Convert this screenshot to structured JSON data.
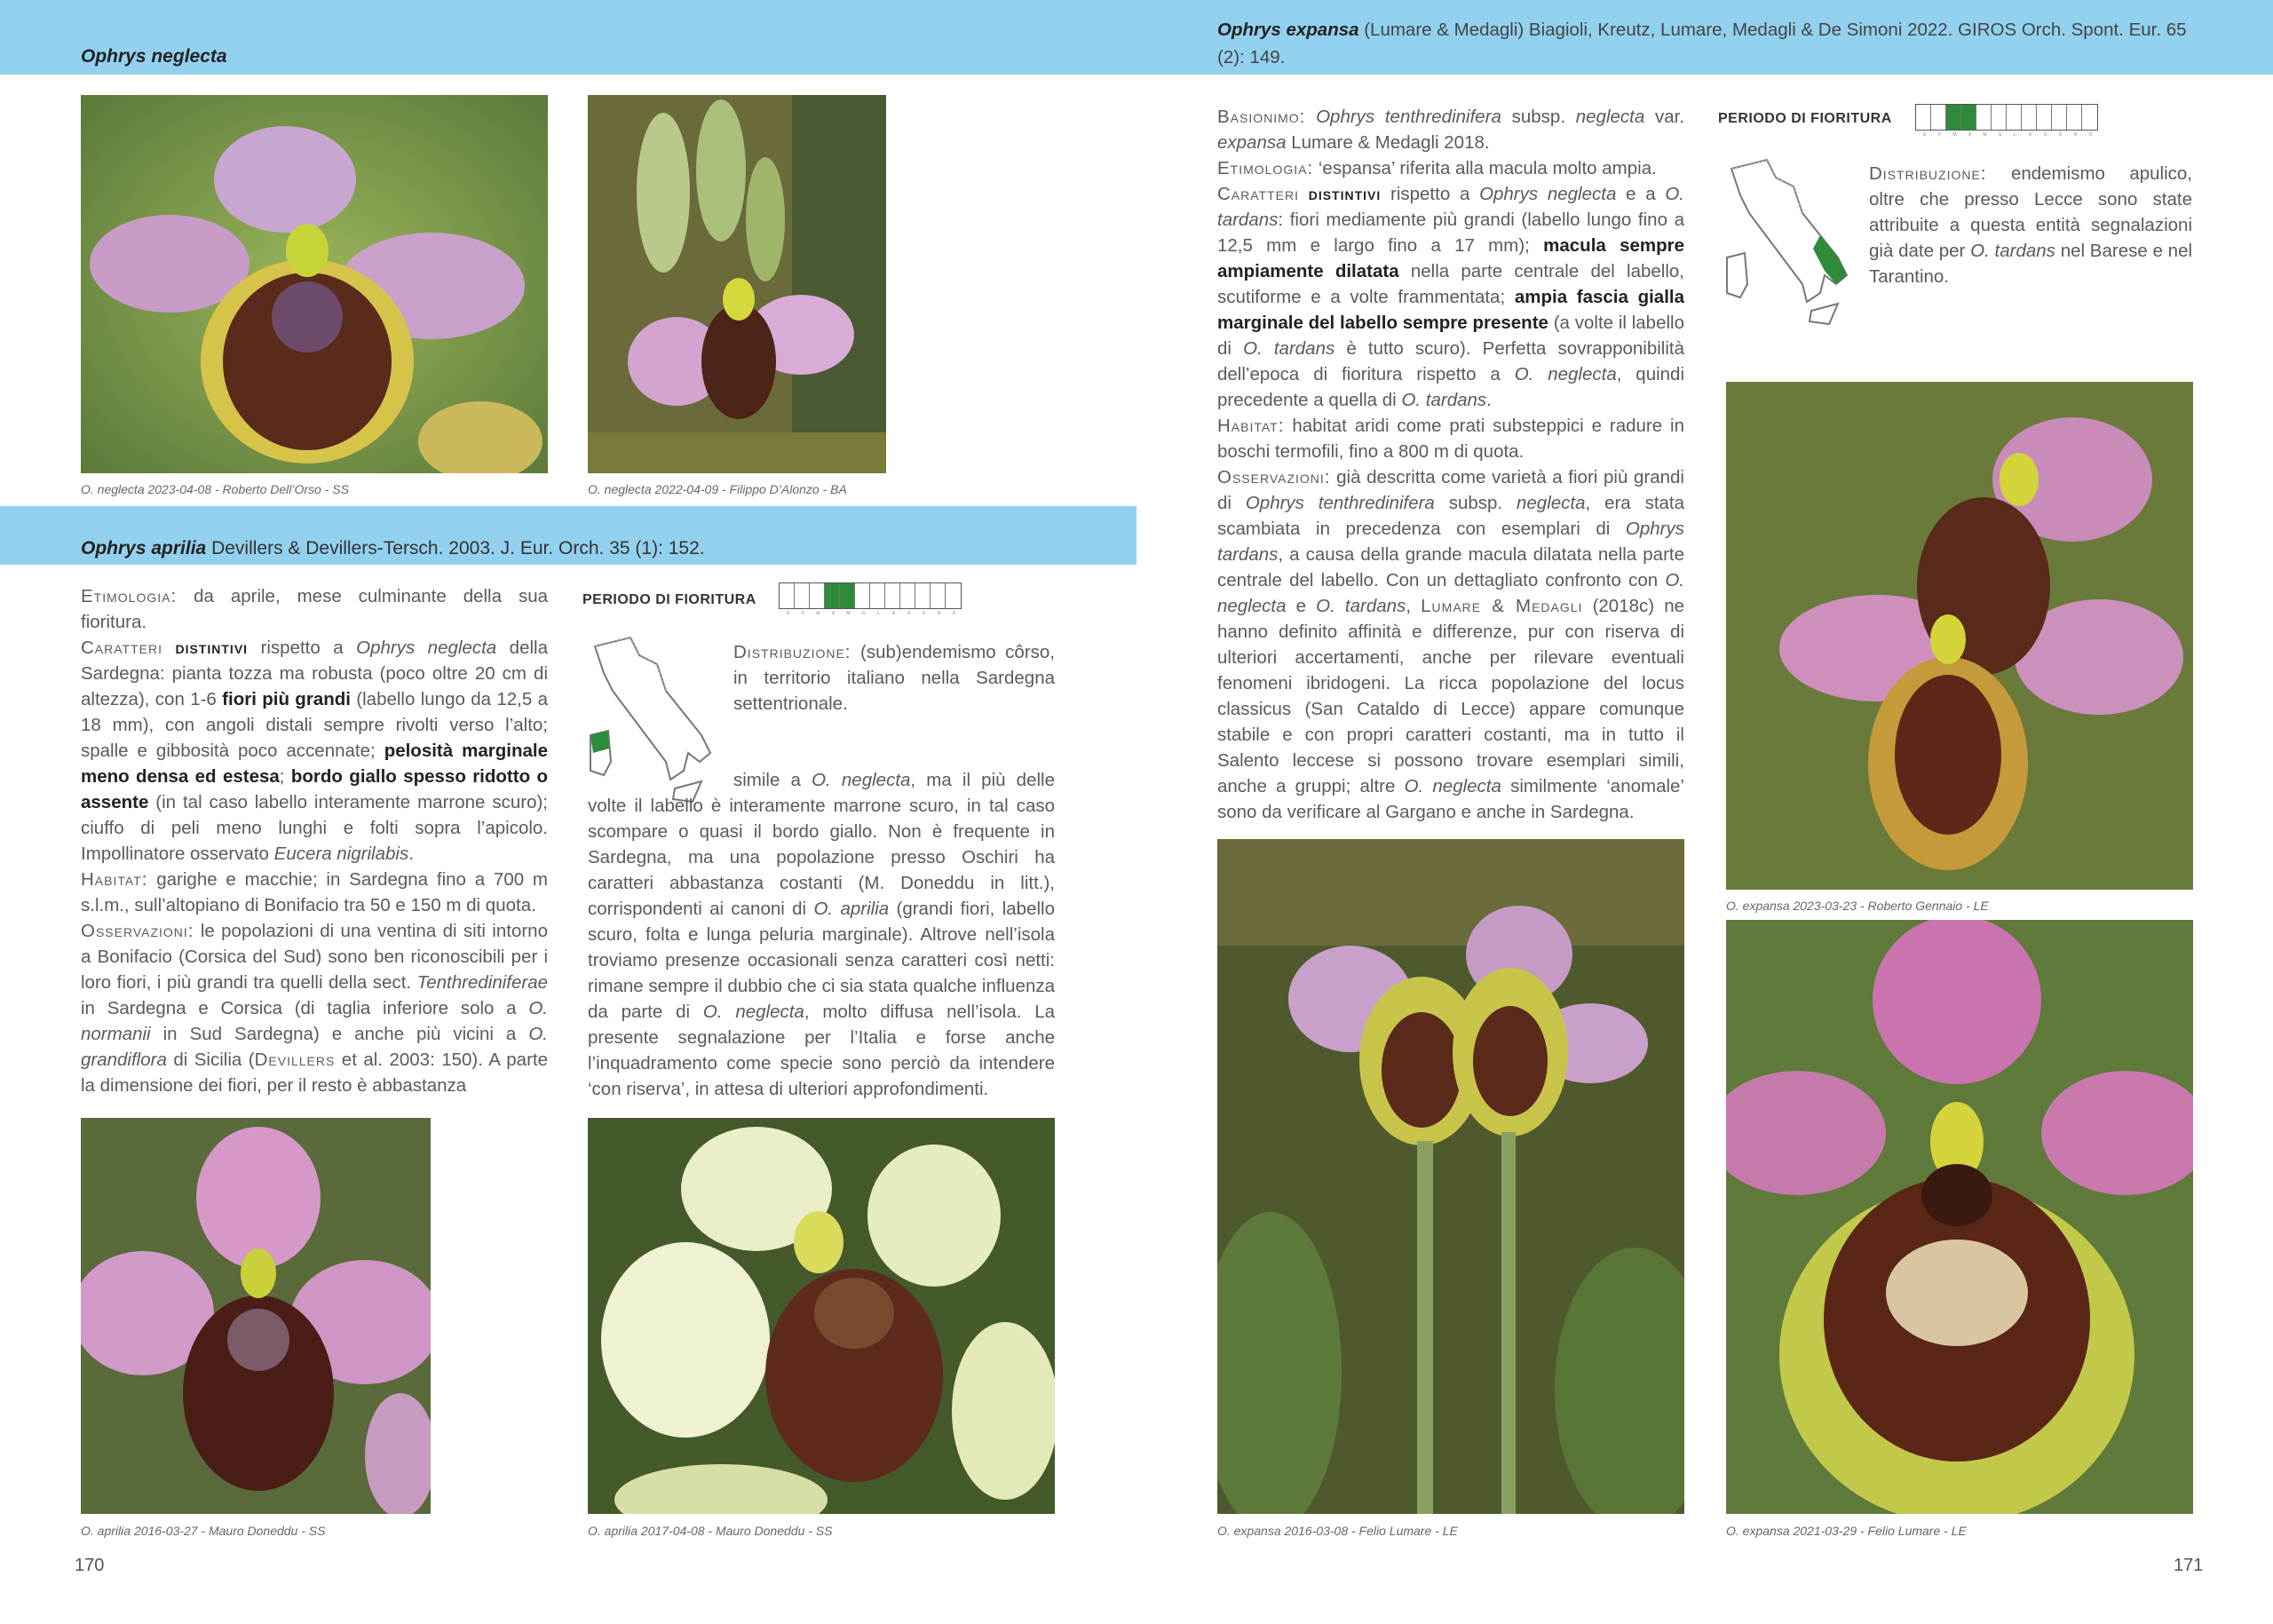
{
  "left_page": {
    "header_title": "Ophrys neglecta",
    "photos_top": [
      {
        "caption": "O. neglecta 2023-04-08 - Roberto Dell’Orso - SS"
      },
      {
        "caption": "O. neglecta 2022-04-09 - Filippo D’Alonzo - BA"
      }
    ],
    "species": {
      "name": "Ophrys aprilia",
      "authority": "Devillers & Devillers-Tersch. 2003. J. Eur. Orch. 35 (1): 152."
    },
    "fioritura_label": "PERIODO DI FIORITURA",
    "months": [
      "G",
      "F",
      "M",
      "A",
      "M",
      "G",
      "L",
      "A",
      "S",
      "O",
      "N",
      "D"
    ],
    "fioritura_active": [
      3,
      4
    ],
    "distribution": {
      "label": "Distribuzione:",
      "text": "(sub)endemismo côrso, in territorio italiano nella Sardegna settentrionale."
    },
    "col1": {
      "etimologia_label": "Etimologia:",
      "etimologia": "da aprile, mese culminante della sua fioritura.",
      "caratteri_label": "Caratteri",
      "distintivi_label": "distintivi",
      "caratteri_a": "rispetto a",
      "caratteri_sp": "Ophrys neglecta",
      "caratteri_b": "della Sardegna: pianta tozza ma robusta (poco oltre 20 cm di altezza), con 1-6",
      "bold1": "fiori più grandi",
      "caratteri_c": "(labello lungo da 12,5 a 18 mm), con angoli distali sempre rivolti verso l’alto; spalle e gibbosità poco accennate;",
      "bold2": "pelosità marginale meno densa ed estesa",
      "semi": ";",
      "bold3": "bordo giallo spesso ridotto o assente",
      "caratteri_d": "(in tal caso labello interamente marrone scuro); ciuffo di peli meno lunghi e folti sopra l’apicolo. Impollinatore osservato",
      "impollinatore": "Eucera nigrilabis",
      "period": ".",
      "habitat_label": "Habitat:",
      "habitat": "garighe e macchie; in Sardegna fino a 700 m s.l.m., sull’altopiano di Bonifacio tra 50 e 150 m di quota.",
      "oss_label": "Osservazioni:",
      "oss_a": "le popolazioni di una ventina di siti intorno a Bonifacio (Corsica del Sud) sono ben riconoscibili per i loro fiori, i più grandi tra quelli della sect.",
      "oss_sect": "Tenthrediniferae",
      "oss_b": "in Sardegna e Corsica (di taglia inferiore solo a",
      "oss_normanii": "O. normanii",
      "oss_c": "in Sud Sardegna) e anche più vicini a",
      "oss_grandiflora": "O. grandiflora",
      "oss_d": "di Sicilia (",
      "oss_devillers": "Devillers",
      "oss_e": "et al. 2003: 150). A parte la dimensione dei fiori, per il resto è abbastanza"
    },
    "col2": {
      "a": "simile a",
      "neglecta1": "O. neglecta",
      "b": ", ma il più delle volte il labello è interamente marrone scuro, in tal caso scompare o quasi il bordo giallo. Non è frequente in Sardegna, ma una popolazione presso Oschiri ha caratteri abbastanza costanti (M. Doneddu in litt.), corrispondenti ai canoni di",
      "aprilia": "O. aprilia",
      "c": "(grandi fiori, labello scuro, folta e lunga peluria marginale). Altrove nell’isola troviamo presenze occasionali senza caratteri così netti: rimane sempre il dubbio che ci sia stata qualche influenza da parte di",
      "neglecta2": "O. neglecta",
      "d": ", molto diffusa nell’isola. La presente segnalazione per l’Italia e forse anche l’inquadramento come specie sono perciò da intendere ‘con riserva’, in attesa di ulteriori approfondimenti."
    },
    "photos_bottom": [
      {
        "caption": "O. aprilia 2016-03-27 - Mauro Doneddu - SS"
      },
      {
        "caption": "O. aprilia 2017-04-08 - Mauro Doneddu - SS"
      }
    ],
    "page_number": "170"
  },
  "right_page": {
    "header_name": "Ophrys expansa",
    "header_authority": "(Lumare & Medagli) Biagioli, Kreutz, Lumare, Medagli & De Simoni 2022. GIROS Orch. Spont. Eur. 65 (2): 149.",
    "fioritura_label": "PERIODO DI FIORITURA",
    "fioritura_active": [
      2,
      3
    ],
    "distribution": {
      "label": "Distribuzione:",
      "text_a": "endemismo apulico, oltre che presso Lecce sono state attribuite a questa entità segnalazioni già date per",
      "tardans": "O. tardans",
      "text_b": "nel Barese e nel Tarantino."
    },
    "body": {
      "basionimo_label": "Basionimo:",
      "basionimo_a": "Ophrys tenthredinifera",
      "basionimo_b": "subsp.",
      "basionimo_c": "neglecta",
      "basionimo_d": "var.",
      "basionimo_e": "expansa",
      "basionimo_f": "Lumare & Medagli 2018.",
      "etimologia_label": "Etimologia:",
      "etimologia": "‘espansa’ riferita alla macula molto ampia.",
      "caratteri_label": "Caratteri",
      "distintivi_label": "distintivi",
      "car_a": "rispetto a",
      "car_neglecta": "Ophrys neglecta",
      "car_b": "e a",
      "car_tardans": "O. tardans",
      "car_c": ": fiori mediamente più grandi (labello lungo fino a 12,5 mm e largo fino a 17 mm);",
      "bold1": "macula sempre ampiamente dilatata",
      "car_d": "nella parte centrale del labello, scutiforme e a volte frammentata;",
      "bold2": "ampia fascia gialla marginale del labello sempre presente",
      "car_e": "(a volte il labello di",
      "car_tardans2": "O. tardans",
      "car_f": "è tutto scuro). Perfetta sovrapponibilità dell’epoca di fioritura rispetto a",
      "car_neglecta2": "O. neglecta",
      "car_g": ", quindi precedente a quella di",
      "car_tardans3": "O. tardans",
      "car_h": ".",
      "habitat_label": "Habitat:",
      "habitat": "habitat aridi come prati substeppici e radure in boschi termofili, fino a 800 m di quota.",
      "oss_label": "Osservazioni:",
      "oss_a": "già descritta come varietà a fiori più grandi di",
      "oss_tenthr": "Ophrys tenthredinifera",
      "oss_b": "subsp.",
      "oss_neglecta": "neglecta",
      "oss_c": ", era stata scambiata in precedenza con esemplari di",
      "oss_tardans": "Ophrys tardans",
      "oss_d": ", a causa della grande macula dilatata nella parte centrale del labello. Con un dettagliato confronto con",
      "oss_neglecta2": "O. neglecta",
      "oss_e": "e",
      "oss_tardans2": "O. tardans",
      "oss_f": ",",
      "oss_lumare": "Lumare & Medagli",
      "oss_g": "(2018c) ne hanno definito affinità e differenze, pur con riserva di ulteriori accertamenti, anche per rilevare eventuali fenomeni ibridogeni. La ricca popolazione del locus classicus (San Cataldo di Lecce) appare comunque stabile e con propri caratteri costanti, ma in tutto il Salento leccese si possono trovare esemplari simili, anche a gruppi; altre",
      "oss_neglecta3": "O. neglecta",
      "oss_h": "similmente ‘anomale’ sono da verificare al Gargano e anche in Sardegna."
    },
    "photos": [
      {
        "caption": "O. expansa 2023-03-23 - Roberto Gennaio - LE"
      },
      {
        "caption": "O. expansa 2016-03-08 - Felio Lumare - LE"
      },
      {
        "caption": "O. expansa 2021-03-29 - Felio Lumare - LE"
      }
    ],
    "page_number": "171"
  },
  "colors": {
    "band": "#92d0ef",
    "green": "#2e8b3a"
  }
}
